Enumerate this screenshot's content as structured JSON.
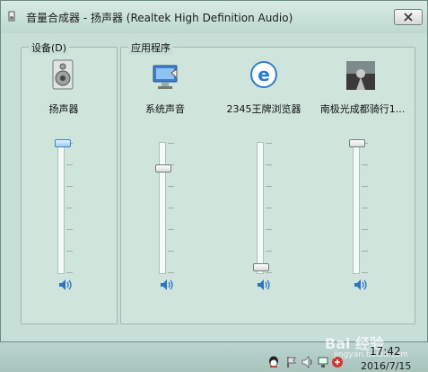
{
  "window": {
    "title": "音量合成器 - 扬声器 (Realtek High Definition Audio)"
  },
  "device_group": {
    "label": "设备(D)",
    "channel": {
      "name": "扬声器",
      "icon": "speaker-device-icon",
      "volume_percent": 100,
      "muted": false
    }
  },
  "apps_group": {
    "label": "应用程序",
    "channels": [
      {
        "name": "系统声音",
        "icon": "system-sounds-icon",
        "volume_percent": 80,
        "muted": false
      },
      {
        "name": "2345王牌浏览器",
        "icon": "browser-e-icon",
        "volume_percent": 0,
        "muted": false
      },
      {
        "name": "南极光成都骑行1...",
        "icon": "video-thumbnail-icon",
        "volume_percent": 100,
        "muted": false
      }
    ]
  },
  "taskbar": {
    "time": "17:42",
    "date": "2016/7/15"
  },
  "watermark": {
    "text": "Bai 经验",
    "sub": "jingyan.baidu.com"
  }
}
